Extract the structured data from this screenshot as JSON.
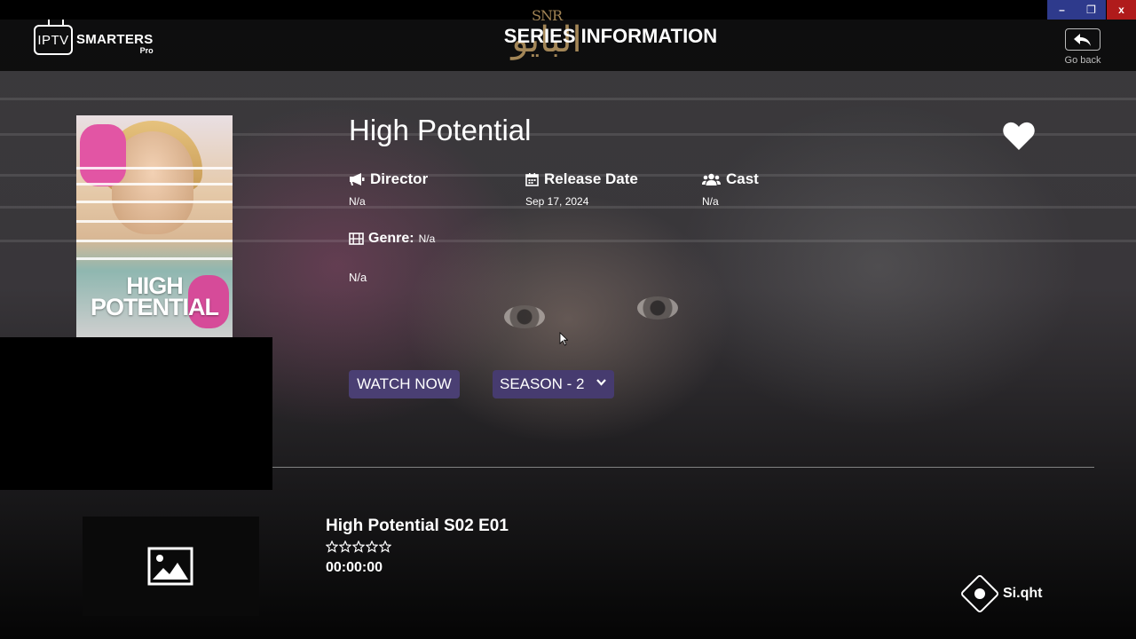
{
  "window_controls": {
    "minimize": "–",
    "maximize": "❐",
    "close": "x"
  },
  "header": {
    "logo_tv": "IPTV",
    "logo_brand": "SMARTERS",
    "logo_sub": "Pro",
    "page_title": "SERIES INFORMATION",
    "go_back_label": "Go back"
  },
  "watermark": {
    "top": "SNR",
    "main": "البايو"
  },
  "poster": {
    "title": "HIGH POTENTIAL"
  },
  "series": {
    "title": "High Potential",
    "director_label": "Director",
    "director_value": "N/a",
    "release_label": "Release Date",
    "release_value": "Sep 17, 2024",
    "cast_label": "Cast",
    "cast_value": "N/a",
    "genre_label": "Genre:",
    "genre_value": "N/a",
    "plot": "N/a"
  },
  "actions": {
    "watch_now": "WATCH NOW",
    "season": "SEASON - 2"
  },
  "episodes": [
    {
      "title": "High Potential S02 E01",
      "rating": 0,
      "duration": "00:00:00"
    }
  ],
  "overlay_badge": "Si.qht",
  "colors": {
    "button_bg": "#4a3f73",
    "close_red": "#b01b1b",
    "window_btn_blue": "#2e3a8c"
  }
}
